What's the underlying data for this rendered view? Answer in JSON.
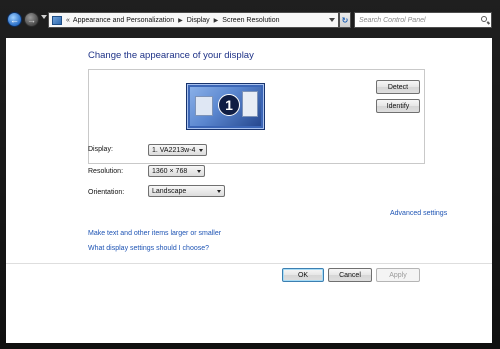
{
  "address": {
    "breadcrumbs": [
      "Appearance and Personalization",
      "Display",
      "Screen Resolution"
    ]
  },
  "search": {
    "placeholder": "Search Control Panel"
  },
  "page": {
    "title": "Change the appearance of your display"
  },
  "monitor": {
    "number": "1"
  },
  "buttons": {
    "detect": "Detect",
    "identify": "Identify",
    "ok": "OK",
    "cancel": "Cancel",
    "apply": "Apply"
  },
  "fields": {
    "display": {
      "label": "Display:",
      "value": "1. VA2213w-4"
    },
    "resolution": {
      "label": "Resolution:",
      "value": "1360 × 768"
    },
    "orientation": {
      "label": "Orientation:",
      "value": "Landscape"
    }
  },
  "links": {
    "advanced": "Advanced settings",
    "text_size": "Make text and other items larger or smaller",
    "which_settings": "What display settings should I choose?"
  }
}
